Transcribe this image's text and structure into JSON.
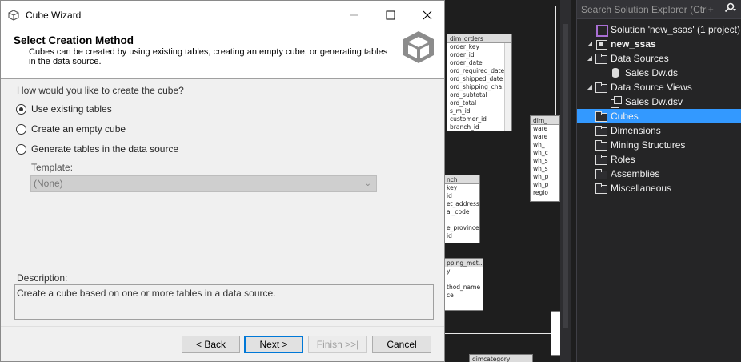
{
  "wizard": {
    "title": "Cube Wizard",
    "controls": {
      "minimize": "—",
      "maximize": "☐",
      "close": "✕"
    },
    "header": {
      "title": "Select Creation Method",
      "description": "Cubes can be created by using existing tables, creating an empty cube, or generating tables in the data source."
    },
    "question": "How would you like to create the cube?",
    "options": [
      {
        "label": "Use existing tables",
        "selected": true
      },
      {
        "label": "Create an empty cube",
        "selected": false
      },
      {
        "label": "Generate tables in the data source",
        "selected": false
      }
    ],
    "template": {
      "label": "Template:",
      "value": "(None)",
      "enabled": false
    },
    "description": {
      "label": "Description:",
      "text": "Create a cube based on one or more tables in a data source."
    },
    "buttons": {
      "back": "< Back",
      "next": "Next >",
      "finish": "Finish >>|",
      "cancel": "Cancel"
    }
  },
  "explorer": {
    "search_placeholder": "Search Solution Explorer (Ctrl+",
    "search_icon": "search-icon",
    "tree": [
      {
        "label": "Solution 'new_ssas' (1 project)",
        "icon": "solution-icon",
        "level": 0,
        "expanded": null,
        "bold": false
      },
      {
        "label": "new_ssas",
        "icon": "project-icon",
        "level": 0,
        "expanded": true,
        "bold": true
      },
      {
        "label": "Data Sources",
        "icon": "folder-icon",
        "level": 1,
        "expanded": true,
        "bold": false
      },
      {
        "label": "Sales Dw.ds",
        "icon": "datasource-icon",
        "level": 2,
        "expanded": null,
        "bold": false
      },
      {
        "label": "Data Source Views",
        "icon": "folder-icon",
        "level": 1,
        "expanded": true,
        "bold": false
      },
      {
        "label": "Sales Dw.dsv",
        "icon": "dsv-icon",
        "level": 2,
        "expanded": null,
        "bold": false
      },
      {
        "label": "Cubes",
        "icon": "folder-icon",
        "level": 1,
        "expanded": null,
        "bold": false,
        "selected": true
      },
      {
        "label": "Dimensions",
        "icon": "folder-icon",
        "level": 1,
        "expanded": null,
        "bold": false
      },
      {
        "label": "Mining Structures",
        "icon": "folder-icon",
        "level": 1,
        "expanded": null,
        "bold": false
      },
      {
        "label": "Roles",
        "icon": "folder-icon",
        "level": 1,
        "expanded": null,
        "bold": false
      },
      {
        "label": "Assemblies",
        "icon": "folder-icon",
        "level": 1,
        "expanded": null,
        "bold": false
      },
      {
        "label": "Miscellaneous",
        "icon": "folder-icon",
        "level": 1,
        "expanded": null,
        "bold": false
      }
    ]
  },
  "designer": {
    "tables": [
      {
        "name": "dim_orders",
        "columns": [
          "order_key",
          "order_id",
          "order_date",
          "ord_required_date",
          "ord_shipped_date",
          "ord_shipping_cha...",
          "ord_subtotal",
          "ord_total",
          "s_m_id",
          "customer_id",
          "branch_id"
        ]
      },
      {
        "name": "dim_",
        "columns": [
          "ware",
          "ware",
          "wh_",
          "wh_c",
          "wh_s",
          "wh_s",
          "wh_p",
          "wh_p",
          "regio"
        ]
      },
      {
        "name": "nch",
        "columns": [
          "key",
          "id",
          "et_address",
          "al_code",
          "",
          "e_province",
          "id"
        ]
      },
      {
        "name": "pping_met...",
        "columns": [
          "y",
          "",
          "thod_name",
          "ce"
        ]
      },
      {
        "name": "dimcategory",
        "columns": []
      }
    ]
  }
}
